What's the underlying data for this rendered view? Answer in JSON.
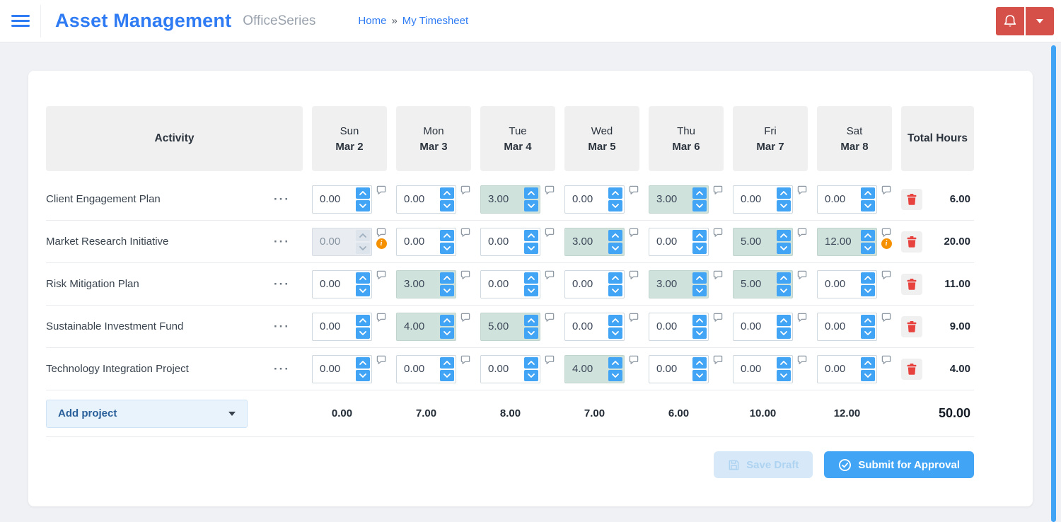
{
  "header": {
    "title": "Asset Management",
    "subtitle": "OfficeSeries",
    "breadcrumb": {
      "home": "Home",
      "separator": "»",
      "current": "My Timesheet"
    }
  },
  "icons": {
    "menu": "hamburger",
    "notifications": "bell",
    "account": "caret-down",
    "comment": "speech-bubble",
    "warning": "info-circle",
    "delete": "trash",
    "save": "floppy-disk",
    "submit": "check-circle"
  },
  "colors": {
    "accent_blue": "#41a4f5",
    "title_blue": "#2e7bf3",
    "danger_red": "#d6504a",
    "trash_red": "#e8423f",
    "warning_orange": "#f59100",
    "filled_cell_teal": "#cfe2dc"
  },
  "timesheet": {
    "activity_header": "Activity",
    "total_header": "Total Hours",
    "days": [
      {
        "day": "Sun",
        "date": "Mar 2"
      },
      {
        "day": "Mon",
        "date": "Mar 3"
      },
      {
        "day": "Tue",
        "date": "Mar 4"
      },
      {
        "day": "Wed",
        "date": "Mar 5"
      },
      {
        "day": "Thu",
        "date": "Mar 6"
      },
      {
        "day": "Fri",
        "date": "Mar 7"
      },
      {
        "day": "Sat",
        "date": "Mar 8"
      }
    ],
    "rows": [
      {
        "activity": "Client Engagement Plan",
        "cells": [
          {
            "value": "0.00"
          },
          {
            "value": "0.00"
          },
          {
            "value": "3.00",
            "filled": true
          },
          {
            "value": "0.00"
          },
          {
            "value": "3.00",
            "filled": true
          },
          {
            "value": "0.00"
          },
          {
            "value": "0.00"
          }
        ],
        "total": "6.00"
      },
      {
        "activity": "Market Research Initiative",
        "cells": [
          {
            "value": "0.00",
            "disabled": true,
            "warning": true
          },
          {
            "value": "0.00"
          },
          {
            "value": "0.00"
          },
          {
            "value": "3.00",
            "filled": true
          },
          {
            "value": "0.00"
          },
          {
            "value": "5.00",
            "filled": true
          },
          {
            "value": "12.00",
            "filled": true,
            "warning": true
          }
        ],
        "total": "20.00"
      },
      {
        "activity": "Risk Mitigation Plan",
        "cells": [
          {
            "value": "0.00"
          },
          {
            "value": "3.00",
            "filled": true
          },
          {
            "value": "0.00"
          },
          {
            "value": "0.00"
          },
          {
            "value": "3.00",
            "filled": true
          },
          {
            "value": "5.00",
            "filled": true
          },
          {
            "value": "0.00"
          }
        ],
        "total": "11.00"
      },
      {
        "activity": "Sustainable Investment Fund",
        "cells": [
          {
            "value": "0.00"
          },
          {
            "value": "4.00",
            "filled": true
          },
          {
            "value": "5.00",
            "filled": true
          },
          {
            "value": "0.00"
          },
          {
            "value": "0.00"
          },
          {
            "value": "0.00"
          },
          {
            "value": "0.00"
          }
        ],
        "total": "9.00"
      },
      {
        "activity": "Technology Integration Project",
        "cells": [
          {
            "value": "0.00"
          },
          {
            "value": "0.00"
          },
          {
            "value": "0.00"
          },
          {
            "value": "4.00",
            "filled": true
          },
          {
            "value": "0.00"
          },
          {
            "value": "0.00"
          },
          {
            "value": "0.00"
          }
        ],
        "total": "4.00"
      }
    ],
    "footer": {
      "add_project_label": "Add project",
      "day_totals": [
        "0.00",
        "7.00",
        "8.00",
        "7.00",
        "6.00",
        "10.00",
        "12.00"
      ],
      "grand_total": "50.00"
    },
    "actions": {
      "save_draft_label": "Save Draft",
      "submit_label": "Submit for Approval"
    }
  }
}
